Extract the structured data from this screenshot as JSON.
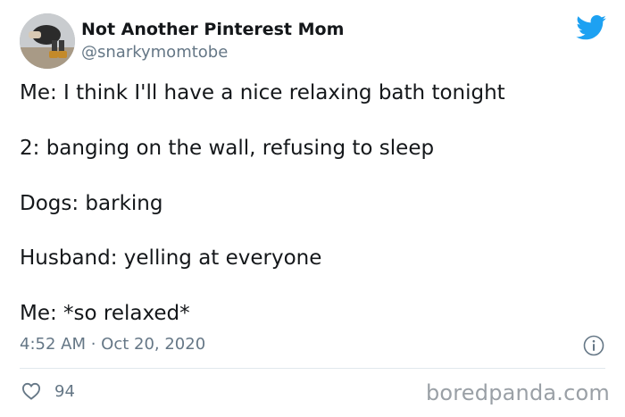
{
  "header": {
    "display_name": "Not Another Pinterest Mom",
    "handle": "@snarkymomtobe",
    "avatar_icon": "profile-photo",
    "platform_icon": "twitter-bird-icon",
    "accent_color": "#1da1f2"
  },
  "tweet": {
    "lines": [
      "Me: I think I'll have a nice relaxing bath tonight",
      "2: banging on the wall, refusing to sleep",
      "Dogs: barking",
      "Husband: yelling at everyone",
      "Me: *so relaxed*"
    ],
    "timestamp": "4:52 AM · Oct 20, 2020"
  },
  "actions": {
    "like_icon": "heart-icon",
    "like_count": "94",
    "info_icon": "info-icon"
  },
  "watermark": {
    "text": "boredpanda.com"
  }
}
